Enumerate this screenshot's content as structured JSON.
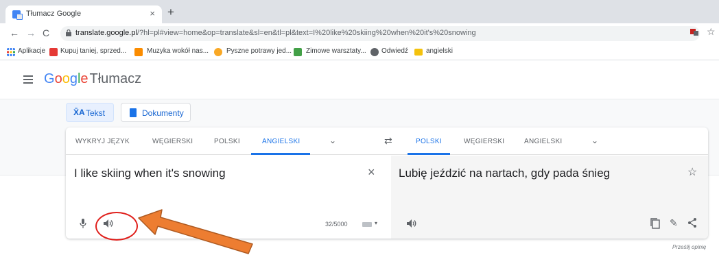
{
  "browser": {
    "tab_title": "Tłumacz Google",
    "tab_close": "×",
    "new_tab": "+",
    "nav_back": "←",
    "nav_forward": "→",
    "nav_reload": "C",
    "url_host": "translate.google.pl",
    "url_path": "/?hl=pl#view=home&op=translate&sl=en&tl=pl&text=I%20like%20skiing%20when%20it's%20snowing",
    "star": "☆"
  },
  "bookmarks": [
    {
      "label": "Aplikacje",
      "icon": "apps-grid-icon",
      "color": "#4285f4"
    },
    {
      "label": "Kupuj taniej, sprzed...",
      "icon": "allegro-icon",
      "color": "#e53935"
    },
    {
      "label": "Muzyka wokół nas...",
      "icon": "music-icon",
      "color": "#fb8c00"
    },
    {
      "label": "Pyszne potrawy jed...",
      "icon": "food-icon",
      "color": "#f9a825"
    },
    {
      "label": "Zimowe warsztaty...",
      "icon": "workshop-icon",
      "color": "#43a047"
    },
    {
      "label": "Odwiedź",
      "icon": "globe-icon",
      "color": "#5f6368"
    },
    {
      "label": "angielski",
      "icon": "folder-icon",
      "color": "#f4c20d"
    }
  ],
  "header": {
    "logo_letters": [
      "G",
      "o",
      "o",
      "g",
      "l",
      "e"
    ],
    "product": "Tłumacz"
  },
  "modes": {
    "text_label": "Tekst",
    "text_icon": "X̄A",
    "docs_label": "Dokumenty"
  },
  "languages": {
    "source": [
      "WYKRYJ JĘZYK",
      "WĘGIERSKI",
      "POLSKI",
      "ANGIELSKI"
    ],
    "source_active": "ANGIELSKI",
    "target": [
      "POLSKI",
      "WĘGIERSKI",
      "ANGIELSKI"
    ],
    "target_active": "POLSKI",
    "chevron": "⌄",
    "swap": "⇄"
  },
  "source": {
    "text": "I like skiing when it's snowing",
    "clear": "×",
    "counter": "32/5000",
    "kbd_chevron": "▾"
  },
  "target": {
    "text": "Lubię jeździć na nartach, gdy pada śnieg",
    "star": "☆",
    "edit": "✎"
  },
  "feedback": "Prześlij opinię",
  "colors": {
    "accent": "#1a73e8",
    "annotation_red": "#e0201c",
    "arrow_orange": "#ed7d31",
    "arrow_outline": "#ae5a21"
  }
}
